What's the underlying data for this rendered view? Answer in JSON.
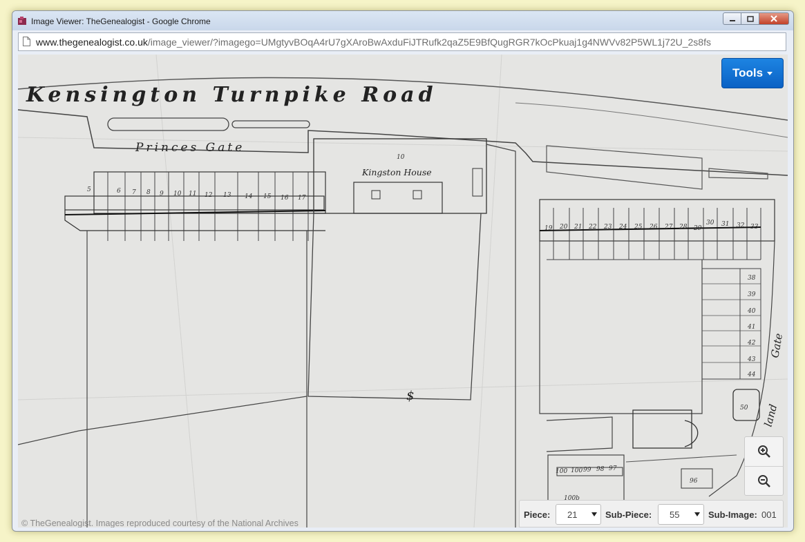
{
  "window": {
    "title": "Image Viewer: TheGenealogist - Google Chrome",
    "icon": "puzzle-app-icon"
  },
  "address": {
    "domain": "www.thegenealogist.co.uk",
    "path": "/image_viewer/?imagego=UMgtyvBOqA4rU7gXAroBwAxduFiJTRufk2qaZ5E9BfQugRGR7kOcPkuaj1g4NWVv82P5WL1j72U_2s8fs"
  },
  "toolbar": {
    "tools_label": "Tools"
  },
  "map": {
    "road_label": "Kensington Turnpike Road",
    "gate_label": "Princes Gate",
    "house_label": "Kingston House",
    "house_number": "10",
    "right_gate_label": "Gate",
    "right_land_label": "land",
    "dollar_mark": "$",
    "plots_left": [
      "5",
      "6",
      "7",
      "8",
      "9",
      "10",
      "11",
      "12",
      "13",
      "14",
      "15",
      "16",
      "17"
    ],
    "plots_right": [
      "19",
      "20",
      "21",
      "22",
      "23",
      "24",
      "25",
      "26",
      "27",
      "28",
      "29",
      "30",
      "31",
      "32",
      "33"
    ],
    "plots_column": [
      "38",
      "39",
      "40",
      "41",
      "42",
      "43",
      "44"
    ],
    "plot_50": "50",
    "plots_bottom": [
      "100",
      "100",
      "99",
      "98",
      "97"
    ],
    "plot_100b": "100b",
    "plot_96": "96"
  },
  "piece_bar": {
    "piece_label": "Piece:",
    "piece_value": "21",
    "subpiece_label": "Sub-Piece:",
    "subpiece_value": "55",
    "subimage_label": "Sub-Image:",
    "subimage_value": "001"
  },
  "footer": {
    "copyright": "© TheGenealogist. Images reproduced courtesy of the National Archives"
  },
  "colors": {
    "tools_button": "#0a6ad0",
    "close_button": "#c94a34",
    "page_background": "#f6f4c8"
  }
}
